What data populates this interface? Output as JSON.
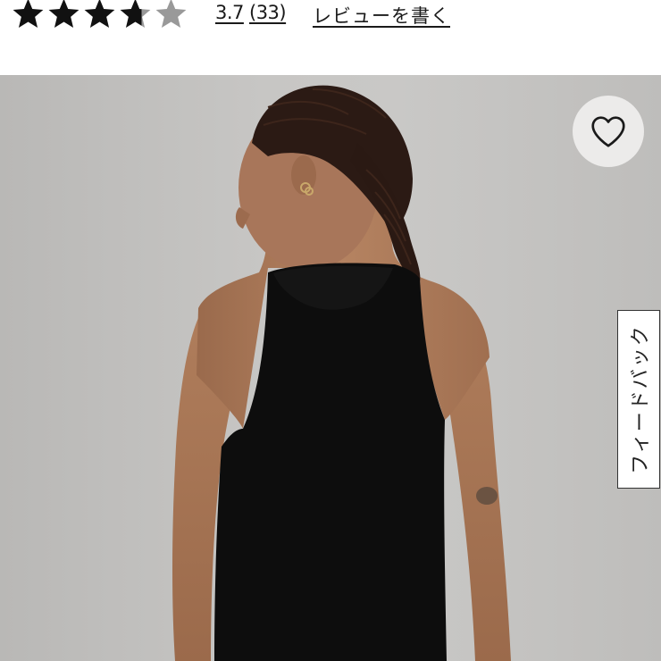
{
  "rating": {
    "value": 3.7,
    "value_text": "3.7",
    "count_text": "(33)",
    "max_stars": 5,
    "write_review_label": "レビューを書く",
    "star_fill_color": "#111111",
    "star_empty_color": "#999999"
  },
  "product_image": {
    "background_color": "#c6c5c3",
    "garment_color": "#0d0d0d"
  },
  "favorite_button": {
    "icon": "heart-outline-icon"
  },
  "feedback_tab": {
    "label": "フィードバック"
  }
}
